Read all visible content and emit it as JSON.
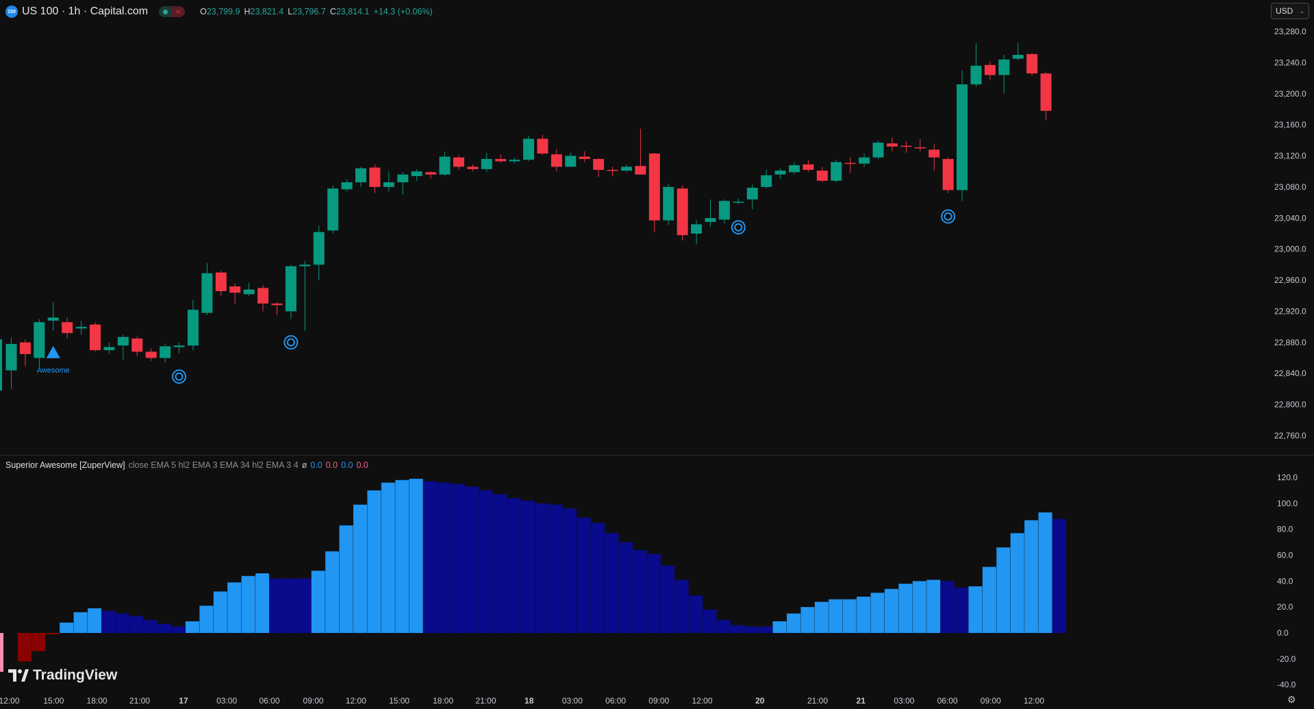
{
  "header": {
    "badge_text": "100",
    "title": "US 100 · 1h · Capital.com",
    "market_icon": "green-dot-icon",
    "wave_icon": "≈",
    "ohlc": {
      "open_label": "O",
      "open": "23,799.9",
      "high_label": "H",
      "high": "23,821.4",
      "low_label": "L",
      "low": "23,796.7",
      "close_label": "C",
      "close": "23,814.1",
      "change": "+14.3 (+0.06%)"
    }
  },
  "currency_selector": {
    "value": "USD",
    "icon": "chevron-down-icon"
  },
  "indicator": {
    "name": "Superior Awesome [ZuperView]",
    "params": "close EMA 5 hl2 EMA 3 EMA 34 hl2 EMA 3 4",
    "null_symbol": "ø",
    "values": [
      "0.0",
      "0.0",
      "0.0",
      "0.0"
    ]
  },
  "brand": {
    "name": "TradingView"
  },
  "colors": {
    "up": "#089981",
    "down": "#f23645",
    "ao_light": "#2196f3",
    "ao_dark": "#0a0a8c",
    "ao_neg_dark": "#8b0000",
    "ao_neg_light": "#f48fb1",
    "marker": "#2196f3",
    "axis_text": "#c8cbd4"
  },
  "chart_data": [
    {
      "type": "candlestick",
      "title": "US 100 · 1h · Capital.com",
      "y_ticks": [
        "23,280.0",
        "23,240.0",
        "23,200.0",
        "23,160.0",
        "23,120.0",
        "23,080.0",
        "23,040.0",
        "23,000.0",
        "22,960.0",
        "22,920.0",
        "22,880.0",
        "22,840.0",
        "22,800.0",
        "22,760.0"
      ],
      "ylim": [
        22740,
        23300
      ],
      "x_ticks": [
        "12:00",
        "15:00",
        "18:00",
        "21:00",
        "17",
        "03:00",
        "06:00",
        "09:00",
        "12:00",
        "15:00",
        "18:00",
        "21:00",
        "18",
        "03:00",
        "06:00",
        "09:00",
        "12:00",
        "20",
        "21:00",
        "21",
        "03:00",
        "06:00",
        "09:00",
        "12:00"
      ],
      "candles": [
        {
          "o": 22844,
          "h": 22886,
          "l": 22820,
          "c": 22878
        },
        {
          "o": 22880,
          "h": 22884,
          "l": 22850,
          "c": 22865
        },
        {
          "o": 22860,
          "h": 22910,
          "l": 22848,
          "c": 22906
        },
        {
          "o": 22908,
          "h": 22932,
          "l": 22895,
          "c": 22912
        },
        {
          "o": 22906,
          "h": 22912,
          "l": 22885,
          "c": 22892
        },
        {
          "o": 22898,
          "h": 22908,
          "l": 22890,
          "c": 22900
        },
        {
          "o": 22903,
          "h": 22906,
          "l": 22868,
          "c": 22870
        },
        {
          "o": 22870,
          "h": 22880,
          "l": 22865,
          "c": 22874
        },
        {
          "o": 22876,
          "h": 22890,
          "l": 22858,
          "c": 22887
        },
        {
          "o": 22885,
          "h": 22888,
          "l": 22862,
          "c": 22868
        },
        {
          "o": 22868,
          "h": 22872,
          "l": 22856,
          "c": 22860
        },
        {
          "o": 22860,
          "h": 22878,
          "l": 22854,
          "c": 22875
        },
        {
          "o": 22874,
          "h": 22880,
          "l": 22866,
          "c": 22876
        },
        {
          "o": 22876,
          "h": 22935,
          "l": 22870,
          "c": 22922
        },
        {
          "o": 22918,
          "h": 22982,
          "l": 22915,
          "c": 22969
        },
        {
          "o": 22970,
          "h": 22972,
          "l": 22940,
          "c": 22946
        },
        {
          "o": 22952,
          "h": 22956,
          "l": 22930,
          "c": 22944
        },
        {
          "o": 22942,
          "h": 22957,
          "l": 22940,
          "c": 22948
        },
        {
          "o": 22950,
          "h": 22954,
          "l": 22920,
          "c": 22930
        },
        {
          "o": 22930,
          "h": 22932,
          "l": 22915,
          "c": 22928
        },
        {
          "o": 22920,
          "h": 22980,
          "l": 22910,
          "c": 22978
        },
        {
          "o": 22978,
          "h": 22985,
          "l": 22895,
          "c": 22980
        },
        {
          "o": 22980,
          "h": 23030,
          "l": 22960,
          "c": 23022
        },
        {
          "o": 23024,
          "h": 23082,
          "l": 23020,
          "c": 23078
        },
        {
          "o": 23077,
          "h": 23090,
          "l": 23074,
          "c": 23086
        },
        {
          "o": 23086,
          "h": 23106,
          "l": 23080,
          "c": 23104
        },
        {
          "o": 23105,
          "h": 23109,
          "l": 23072,
          "c": 23080
        },
        {
          "o": 23080,
          "h": 23100,
          "l": 23074,
          "c": 23086
        },
        {
          "o": 23086,
          "h": 23099,
          "l": 23070,
          "c": 23096
        },
        {
          "o": 23094,
          "h": 23103,
          "l": 23088,
          "c": 23100
        },
        {
          "o": 23099,
          "h": 23100,
          "l": 23091,
          "c": 23096
        },
        {
          "o": 23096,
          "h": 23125,
          "l": 23094,
          "c": 23119
        },
        {
          "o": 23118,
          "h": 23121,
          "l": 23102,
          "c": 23106
        },
        {
          "o": 23106,
          "h": 23109,
          "l": 23100,
          "c": 23103
        },
        {
          "o": 23103,
          "h": 23124,
          "l": 23099,
          "c": 23116
        },
        {
          "o": 23116,
          "h": 23122,
          "l": 23111,
          "c": 23113
        },
        {
          "o": 23113,
          "h": 23118,
          "l": 23110,
          "c": 23115
        },
        {
          "o": 23115,
          "h": 23146,
          "l": 23113,
          "c": 23142
        },
        {
          "o": 23142,
          "h": 23147,
          "l": 23121,
          "c": 23123
        },
        {
          "o": 23122,
          "h": 23129,
          "l": 23100,
          "c": 23106
        },
        {
          "o": 23106,
          "h": 23124,
          "l": 23106,
          "c": 23120
        },
        {
          "o": 23119,
          "h": 23126,
          "l": 23112,
          "c": 23116
        },
        {
          "o": 23116,
          "h": 23117,
          "l": 23093,
          "c": 23102
        },
        {
          "o": 23102,
          "h": 23106,
          "l": 23094,
          "c": 23101
        },
        {
          "o": 23101,
          "h": 23109,
          "l": 23099,
          "c": 23106
        },
        {
          "o": 23107,
          "h": 23155,
          "l": 23096,
          "c": 23096
        },
        {
          "o": 23123,
          "h": 23124,
          "l": 23022,
          "c": 23037
        },
        {
          "o": 23037,
          "h": 23084,
          "l": 23031,
          "c": 23080
        },
        {
          "o": 23078,
          "h": 23082,
          "l": 23011,
          "c": 23018
        },
        {
          "o": 23020,
          "h": 23037,
          "l": 23006,
          "c": 23032
        },
        {
          "o": 23035,
          "h": 23064,
          "l": 23029,
          "c": 23040
        },
        {
          "o": 23038,
          "h": 23064,
          "l": 23033,
          "c": 23062
        },
        {
          "o": 23060,
          "h": 23065,
          "l": 23058,
          "c": 23061
        },
        {
          "o": 23064,
          "h": 23083,
          "l": 23051,
          "c": 23079
        },
        {
          "o": 23080,
          "h": 23102,
          "l": 23078,
          "c": 23095
        },
        {
          "o": 23096,
          "h": 23104,
          "l": 23090,
          "c": 23101
        },
        {
          "o": 23099,
          "h": 23112,
          "l": 23096,
          "c": 23108
        },
        {
          "o": 23109,
          "h": 23114,
          "l": 23099,
          "c": 23102
        },
        {
          "o": 23101,
          "h": 23106,
          "l": 23086,
          "c": 23088
        },
        {
          "o": 23088,
          "h": 23115,
          "l": 23086,
          "c": 23112
        },
        {
          "o": 23111,
          "h": 23118,
          "l": 23098,
          "c": 23110
        },
        {
          "o": 23110,
          "h": 23123,
          "l": 23106,
          "c": 23118
        },
        {
          "o": 23118,
          "h": 23140,
          "l": 23116,
          "c": 23137
        },
        {
          "o": 23136,
          "h": 23144,
          "l": 23126,
          "c": 23132
        },
        {
          "o": 23133,
          "h": 23139,
          "l": 23124,
          "c": 23132
        },
        {
          "o": 23131,
          "h": 23142,
          "l": 23126,
          "c": 23130
        },
        {
          "o": 23128,
          "h": 23135,
          "l": 23101,
          "c": 23118
        },
        {
          "o": 23116,
          "h": 23118,
          "l": 23072,
          "c": 23076
        },
        {
          "o": 23076,
          "h": 23230,
          "l": 23062,
          "c": 23212
        },
        {
          "o": 23212,
          "h": 23265,
          "l": 23209,
          "c": 23236
        },
        {
          "o": 23237,
          "h": 23242,
          "l": 23218,
          "c": 23224
        },
        {
          "o": 23224,
          "h": 23250,
          "l": 23200,
          "c": 23244
        },
        {
          "o": 23245,
          "h": 23265,
          "l": 23243,
          "c": 23250
        },
        {
          "o": 23251,
          "h": 23252,
          "l": 23223,
          "c": 23226
        },
        {
          "o": 23226,
          "h": 23228,
          "l": 23166,
          "c": 23178
        }
      ],
      "markers": [
        {
          "index": 3,
          "shape": "triangle-up",
          "label": "Awesome"
        },
        {
          "index": 12,
          "shape": "target"
        },
        {
          "index": 20,
          "shape": "target"
        },
        {
          "index": 52,
          "shape": "target"
        },
        {
          "index": 67,
          "shape": "target"
        }
      ]
    },
    {
      "type": "bar",
      "title": "Superior Awesome [ZuperView]",
      "y_ticks": [
        "120.0",
        "100.0",
        "80.0",
        "60.0",
        "40.0",
        "20.0",
        "0.0",
        "-20.0",
        "-40.0"
      ],
      "ylim": [
        -45,
        125
      ],
      "series": [
        {
          "values": [
            -30,
            -22,
            -14,
            -1,
            8,
            16,
            19,
            17,
            15,
            13,
            10,
            7,
            5,
            9,
            21,
            32,
            39,
            44,
            46,
            42,
            42,
            42,
            48,
            63,
            83,
            99,
            110,
            116,
            118,
            119,
            117,
            116,
            115,
            113,
            110,
            107,
            104,
            102,
            100,
            99,
            96,
            89,
            85,
            77,
            70,
            64,
            61,
            52,
            41,
            29,
            18,
            10,
            6,
            5,
            5,
            9,
            15,
            20,
            24,
            26,
            26,
            28,
            31,
            34,
            38,
            40,
            41,
            40,
            35,
            36,
            51,
            66,
            77,
            87,
            93,
            88
          ],
          "colors": [
            "light",
            "dark",
            "dark",
            "dark",
            "light",
            "light",
            "light",
            "dark",
            "dark",
            "dark",
            "dark",
            "dark",
            "dark",
            "light",
            "light",
            "light",
            "light",
            "light",
            "light",
            "dark",
            "dark",
            "dark",
            "light",
            "light",
            "light",
            "light",
            "light",
            "light",
            "light",
            "light",
            "dark",
            "dark",
            "dark",
            "dark",
            "dark",
            "dark",
            "dark",
            "dark",
            "dark",
            "dark",
            "dark",
            "dark",
            "dark",
            "dark",
            "dark",
            "dark",
            "dark",
            "dark",
            "dark",
            "dark",
            "dark",
            "dark",
            "dark",
            "dark",
            "dark",
            "light",
            "light",
            "light",
            "light",
            "light",
            "light",
            "light",
            "light",
            "light",
            "light",
            "light",
            "light",
            "dark",
            "dark",
            "light",
            "light",
            "light",
            "light",
            "light",
            "light",
            "dark"
          ]
        }
      ]
    }
  ]
}
